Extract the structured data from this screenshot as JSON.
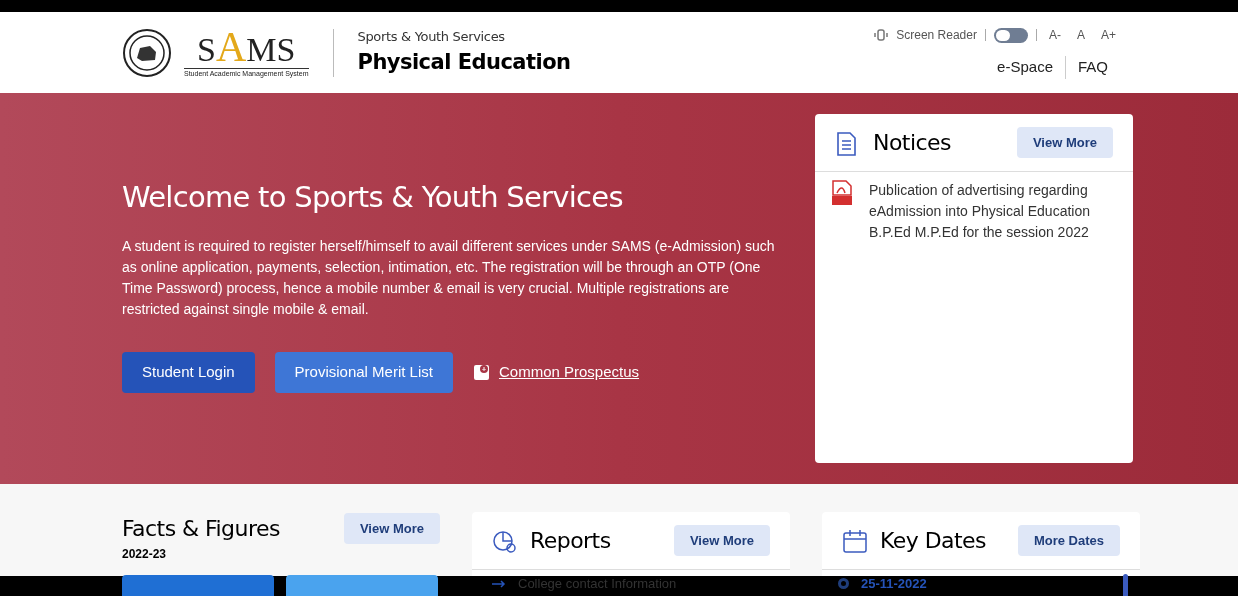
{
  "header": {
    "logo": {
      "text": "SAMS",
      "subtitle": "Student Academic Management System"
    },
    "department": "Sports & Youth Services",
    "portal": "Physical Education",
    "screen_reader": {
      "label": "Screen Reader",
      "on": false
    },
    "font_sizes": [
      "A-",
      "A",
      "A+"
    ],
    "links": [
      "e-Space",
      "FAQ"
    ]
  },
  "hero": {
    "title": "Welcome to Sports & Youth Services",
    "text": "A student is required to register herself/himself to avail different services under SAMS (e-Admission) such as online application, payments, selection, intimation, etc. The registration will be through an OTP (One Time Password) process, hence a mobile number & email is very crucial. Multiple registrations are restricted against single mobile & email.",
    "buttons": [
      {
        "label": "Student Login",
        "kind": "primary"
      },
      {
        "label": "Provisional Merit List",
        "kind": "secondary"
      }
    ],
    "prospectus": "Common Prospectus"
  },
  "notices": {
    "title": "Notices",
    "button": "View More",
    "items": [
      "Publication of advertising regarding eAdmission into Physical Education B.P.Ed M.P.Ed for the session 2022"
    ]
  },
  "facts": {
    "title": "Facts & Figures",
    "button": "View More",
    "year": "2022-23"
  },
  "reports": {
    "title": "Reports",
    "button": "View More",
    "items": [
      "College contact Information"
    ]
  },
  "key_dates": {
    "title": "Key Dates",
    "button": "More Dates",
    "items": [
      "25-11-2022"
    ]
  }
}
